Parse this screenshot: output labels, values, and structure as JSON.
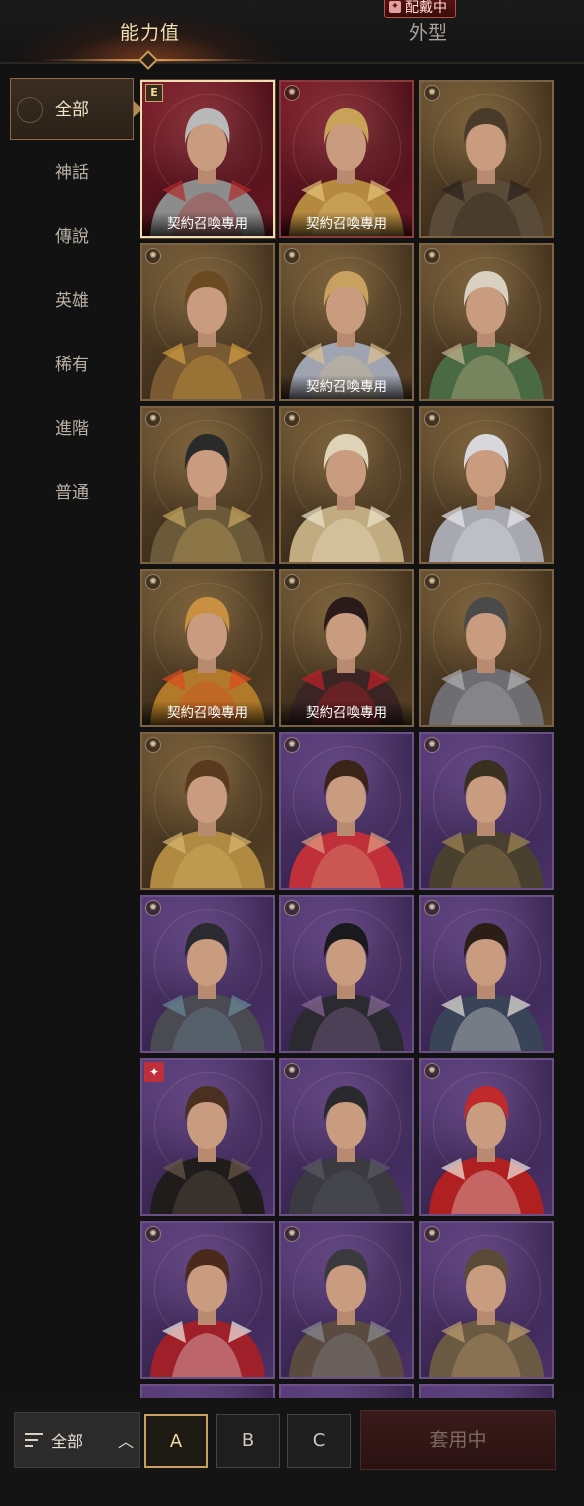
{
  "tabs": {
    "stats": "能力值",
    "appearance": "外型",
    "equipped_badge": "配戴中"
  },
  "sidebar": {
    "items": [
      {
        "label": "全部",
        "active": true
      },
      {
        "label": "神話",
        "active": false
      },
      {
        "label": "傳說",
        "active": false
      },
      {
        "label": "英雄",
        "active": false
      },
      {
        "label": "稀有",
        "active": false
      },
      {
        "label": "進階",
        "active": false
      },
      {
        "label": "普通",
        "active": false
      }
    ]
  },
  "grid": {
    "summon_tag": "契約召喚專用",
    "grade_label": "E",
    "cards": [
      {
        "name": "crimson-silver-knight",
        "frame": "red",
        "badge": "grade",
        "tag": true,
        "selected": true,
        "hair": "#b9b9b9",
        "armor": "#8c8c8c",
        "accent": "#b22b2b"
      },
      {
        "name": "golden-horned-archer",
        "frame": "red",
        "badge": "corner",
        "tag": true,
        "selected": false,
        "hair": "#c9a25a",
        "armor": "#b68a3e",
        "accent": "#e6c27a"
      },
      {
        "name": "dark-dragon-helm",
        "frame": "gold",
        "badge": "corner",
        "tag": false,
        "selected": false,
        "hair": "#4a3a2a",
        "armor": "#5a4a38",
        "accent": "#2a211a"
      },
      {
        "name": "bronze-masked-warrior",
        "frame": "gold",
        "badge": "corner",
        "tag": false,
        "selected": false,
        "hair": "#6b4a22",
        "armor": "#7a5a32",
        "accent": "#d4a040"
      },
      {
        "name": "golden-crowned-mage",
        "frame": "gold",
        "badge": "corner",
        "tag": true,
        "selected": false,
        "hair": "#c8a060",
        "armor": "#a0a4b0",
        "accent": "#d8c090"
      },
      {
        "name": "hooded-emerald-ranger",
        "frame": "gold",
        "badge": "corner",
        "tag": false,
        "selected": false,
        "hair": "#d8d0c0",
        "armor": "#4a6a44",
        "accent": "#c8b890"
      },
      {
        "name": "shadow-hood-assassin",
        "frame": "gold",
        "badge": "corner",
        "tag": false,
        "selected": false,
        "hair": "#2a2a2a",
        "armor": "#6a5a3a",
        "accent": "#c8a860"
      },
      {
        "name": "ivory-masked-priest",
        "frame": "gold",
        "badge": "corner",
        "tag": false,
        "selected": false,
        "hair": "#e0d4b8",
        "armor": "#c0ac80",
        "accent": "#f0e6cc"
      },
      {
        "name": "silver-haired-blademaster",
        "frame": "gold",
        "badge": "corner",
        "tag": false,
        "selected": false,
        "hair": "#d8d8dc",
        "armor": "#a8a8b0",
        "accent": "#e8e8ee"
      },
      {
        "name": "sun-halo-paladin",
        "frame": "gold",
        "badge": "corner",
        "tag": true,
        "selected": false,
        "hair": "#c89040",
        "armor": "#b07a2a",
        "accent": "#e04a20"
      },
      {
        "name": "crimson-demon-lord",
        "frame": "gold",
        "badge": "corner",
        "tag": true,
        "selected": false,
        "hair": "#2a1a1a",
        "armor": "#3a2424",
        "accent": "#c0202a"
      },
      {
        "name": "iron-hood-knight",
        "frame": "gold",
        "badge": "corner",
        "tag": false,
        "selected": false,
        "hair": "#4a4a4a",
        "armor": "#6e6e72",
        "accent": "#b0b0b4"
      },
      {
        "name": "golden-chain-noble",
        "frame": "gold",
        "badge": "corner",
        "tag": false,
        "selected": false,
        "hair": "#5a3a1e",
        "armor": "#b08a40",
        "accent": "#d8b870"
      },
      {
        "name": "sunglasses-lifeguard",
        "frame": "purple",
        "badge": "corner",
        "tag": false,
        "selected": false,
        "hair": "#3a2418",
        "armor": "#c0303a",
        "accent": "#e0a080"
      },
      {
        "name": "thorn-crown-warrior",
        "frame": "purple",
        "badge": "corner",
        "tag": false,
        "selected": false,
        "hair": "#3a3020",
        "armor": "#4a4030",
        "accent": "#a08850"
      },
      {
        "name": "dark-scale-knight",
        "frame": "purple",
        "badge": "corner",
        "tag": false,
        "selected": false,
        "hair": "#2a2a30",
        "armor": "#4a4a52",
        "accent": "#6a8a9a"
      },
      {
        "name": "masked-ninja",
        "frame": "purple",
        "badge": "corner",
        "tag": false,
        "selected": false,
        "hair": "#1a1a1e",
        "armor": "#2a2a30",
        "accent": "#8a6a9a"
      },
      {
        "name": "hanbok-scholar",
        "frame": "purple",
        "badge": "corner",
        "tag": false,
        "selected": false,
        "hair": "#2a1e16",
        "armor": "#3a4458",
        "accent": "#e8e4dc"
      },
      {
        "name": "black-coat-noble",
        "frame": "purple",
        "badge": "new",
        "tag": false,
        "selected": false,
        "hair": "#4a3020",
        "armor": "#201c1c",
        "accent": "#6a5a4a"
      },
      {
        "name": "bat-cowl-vigilante",
        "frame": "purple",
        "badge": "corner",
        "tag": false,
        "selected": false,
        "hair": "#2a2a2e",
        "armor": "#3a3a40",
        "accent": "#5a5a62"
      },
      {
        "name": "santa-hood-brawler",
        "frame": "purple",
        "badge": "corner",
        "tag": false,
        "selected": false,
        "hair": "#c02a2a",
        "armor": "#b02020",
        "accent": "#f0ece4"
      },
      {
        "name": "reindeer-antler-noble",
        "frame": "purple",
        "badge": "corner",
        "tag": false,
        "selected": false,
        "hair": "#4a2a1a",
        "armor": "#a0202a",
        "accent": "#f0ece4"
      },
      {
        "name": "iron-mask-gladiator",
        "frame": "purple",
        "badge": "corner",
        "tag": false,
        "selected": false,
        "hair": "#3a3a3e",
        "armor": "#5a4a40",
        "accent": "#8a8a90"
      },
      {
        "name": "bronze-helm-barbarian",
        "frame": "purple",
        "badge": "corner",
        "tag": false,
        "selected": false,
        "hair": "#5a4a38",
        "armor": "#6a5a42",
        "accent": "#c0a070"
      }
    ]
  },
  "bottom": {
    "filter_label": "全部",
    "presets": [
      {
        "label": "A",
        "active": true
      },
      {
        "label": "B",
        "active": false
      },
      {
        "label": "C",
        "active": false
      }
    ],
    "apply_label": "套用中"
  },
  "colors": {
    "accent_gold": "#c9a060",
    "equipped_red": "#5a1414"
  }
}
